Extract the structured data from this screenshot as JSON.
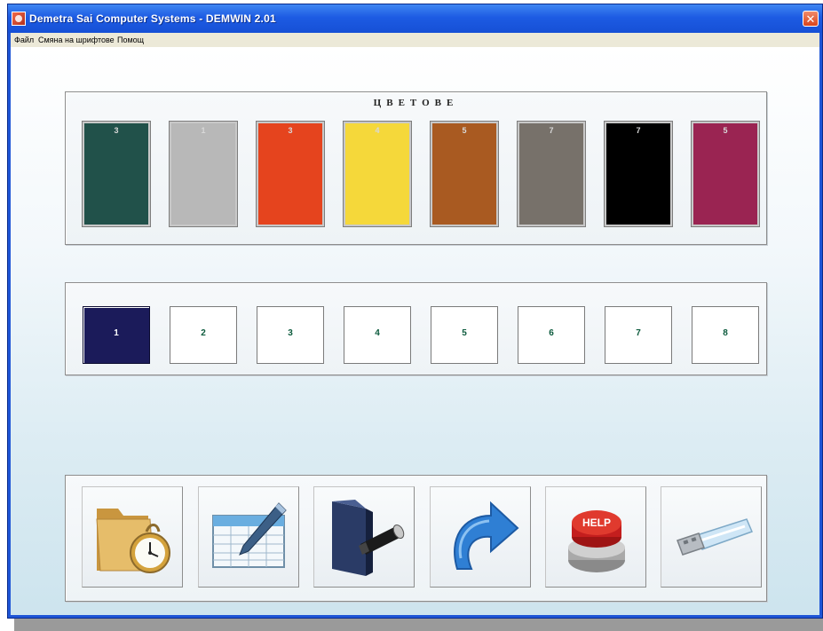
{
  "window": {
    "title": "Demetra Sai Computer Systems - DEMWIN 2.01",
    "close_glyph": "✕"
  },
  "menu": {
    "items": [
      "Файл",
      "Смяна на шрифтове",
      "Помощ"
    ]
  },
  "colors_panel": {
    "title": "ЦВЕТОВЕ",
    "swatches": [
      {
        "label": "3",
        "color": "#21514a"
      },
      {
        "label": "1",
        "color": "#b8b8b8"
      },
      {
        "label": "3",
        "color": "#e5441e"
      },
      {
        "label": "4",
        "color": "#f5d83a"
      },
      {
        "label": "5",
        "color": "#a95a21"
      },
      {
        "label": "7",
        "color": "#77716a"
      },
      {
        "label": "7",
        "color": "#000000"
      },
      {
        "label": "5",
        "color": "#9a2452"
      }
    ]
  },
  "slots_panel": {
    "slots": [
      "1",
      "2",
      "3",
      "4",
      "5",
      "6",
      "7",
      "8"
    ],
    "active_index": 0
  },
  "toolbar": {
    "buttons": [
      {
        "icon": "folder-clock-icon"
      },
      {
        "icon": "spreadsheet-edit-icon"
      },
      {
        "icon": "folder-flashlight-icon"
      },
      {
        "icon": "redo-arrow-icon"
      },
      {
        "icon": "help-button-icon",
        "icon_text": "HELP"
      },
      {
        "icon": "usb-drive-icon"
      }
    ]
  }
}
